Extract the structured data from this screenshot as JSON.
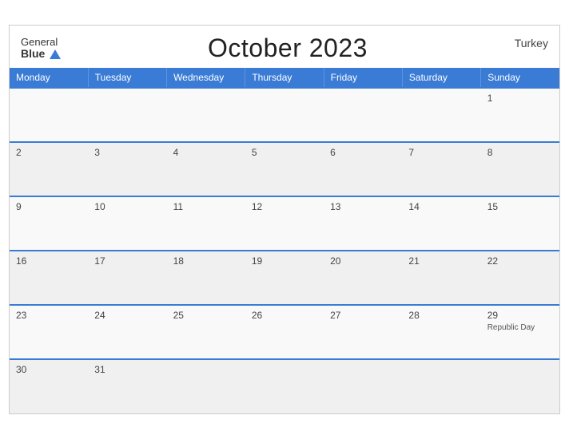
{
  "header": {
    "brand_line1": "General",
    "brand_line2": "Blue",
    "title": "October 2023",
    "country": "Turkey"
  },
  "weekdays": [
    "Monday",
    "Tuesday",
    "Wednesday",
    "Thursday",
    "Friday",
    "Saturday",
    "Sunday"
  ],
  "weeks": [
    [
      {
        "day": "",
        "event": ""
      },
      {
        "day": "",
        "event": ""
      },
      {
        "day": "",
        "event": ""
      },
      {
        "day": "",
        "event": ""
      },
      {
        "day": "",
        "event": ""
      },
      {
        "day": "",
        "event": ""
      },
      {
        "day": "1",
        "event": ""
      }
    ],
    [
      {
        "day": "2",
        "event": ""
      },
      {
        "day": "3",
        "event": ""
      },
      {
        "day": "4",
        "event": ""
      },
      {
        "day": "5",
        "event": ""
      },
      {
        "day": "6",
        "event": ""
      },
      {
        "day": "7",
        "event": ""
      },
      {
        "day": "8",
        "event": ""
      }
    ],
    [
      {
        "day": "9",
        "event": ""
      },
      {
        "day": "10",
        "event": ""
      },
      {
        "day": "11",
        "event": ""
      },
      {
        "day": "12",
        "event": ""
      },
      {
        "day": "13",
        "event": ""
      },
      {
        "day": "14",
        "event": ""
      },
      {
        "day": "15",
        "event": ""
      }
    ],
    [
      {
        "day": "16",
        "event": ""
      },
      {
        "day": "17",
        "event": ""
      },
      {
        "day": "18",
        "event": ""
      },
      {
        "day": "19",
        "event": ""
      },
      {
        "day": "20",
        "event": ""
      },
      {
        "day": "21",
        "event": ""
      },
      {
        "day": "22",
        "event": ""
      }
    ],
    [
      {
        "day": "23",
        "event": ""
      },
      {
        "day": "24",
        "event": ""
      },
      {
        "day": "25",
        "event": ""
      },
      {
        "day": "26",
        "event": ""
      },
      {
        "day": "27",
        "event": ""
      },
      {
        "day": "28",
        "event": ""
      },
      {
        "day": "29",
        "event": "Republic Day"
      }
    ],
    [
      {
        "day": "30",
        "event": ""
      },
      {
        "day": "31",
        "event": ""
      },
      {
        "day": "",
        "event": ""
      },
      {
        "day": "",
        "event": ""
      },
      {
        "day": "",
        "event": ""
      },
      {
        "day": "",
        "event": ""
      },
      {
        "day": "",
        "event": ""
      }
    ]
  ],
  "colors": {
    "header_bg": "#3a7bd5",
    "brand_blue": "#3a7bd5"
  }
}
